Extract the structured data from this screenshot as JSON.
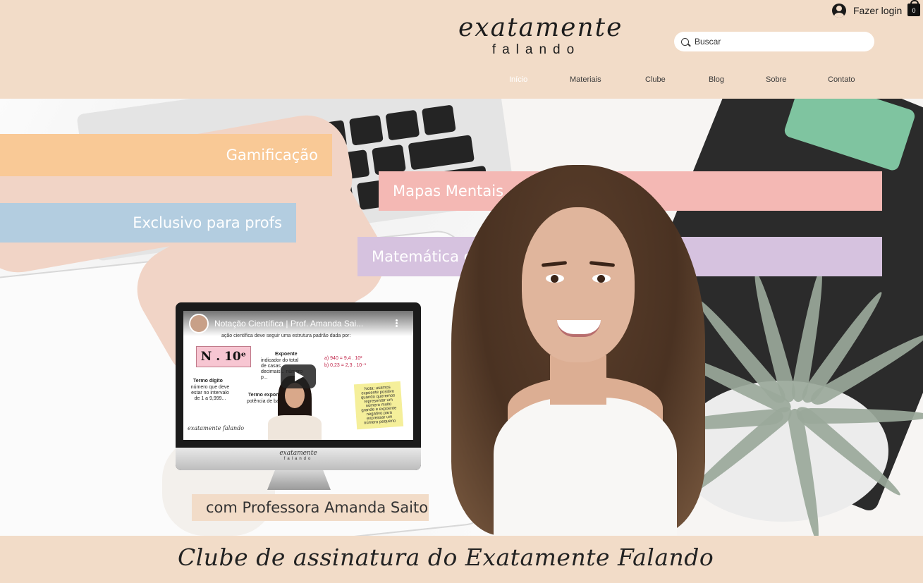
{
  "header": {
    "logo_main": "exatamente",
    "logo_sub": "falando",
    "login_label": "Fazer login",
    "cart_count": "0",
    "search": {
      "placeholder": "Buscar"
    }
  },
  "nav": {
    "items": [
      {
        "label": "Início",
        "active": true
      },
      {
        "label": "Materiais"
      },
      {
        "label": "Clube"
      },
      {
        "label": "Blog"
      },
      {
        "label": "Sobre"
      },
      {
        "label": "Contato"
      }
    ]
  },
  "hero": {
    "tags": {
      "gamificacao": "Gamificação",
      "exclusivo": "Exclusivo para profs",
      "mapas": "Mapas Mentais",
      "matematica": "Matemática criativa"
    },
    "video": {
      "title": "Notação Científica | Prof. Amanda Sai...",
      "subtitle": "ação científica deve seguir uma estrutura padrão dada por:",
      "formula": "N . 10ᵉ",
      "expoente": "Expoente",
      "expoente_desc": "indicador do total de casas decimais... número p...",
      "termo_digito": "Termo dígito",
      "termo_digito_desc": "número que deve estar no intervalo de 1 a 9,999...",
      "termo_exp": "Termo exponencial",
      "termo_exp_desc": "potência de base 10",
      "ex_a": "a) 940  =   9,4 . 10²",
      "ex_b": "b) 0,23 =   2,3 . 10⁻¹",
      "note": "Nota: usamos expoente positivo quando queremos representar um número muito grande e expoente negativo para expressar um número pequeno",
      "screen_logo": "exatamente falando",
      "chin_logo": "exatamente",
      "chin_sub": "falando"
    },
    "caption": "com Professora Amanda Saito"
  },
  "strip": {
    "title": "Clube de assinatura do Exatamente Falando"
  },
  "colors": {
    "header_bg": "#f2dcc8",
    "gamificacao": "#f9c996",
    "exclusivo": "#b3cde0",
    "mapas": "#f4b8b4",
    "matematica": "#d6c2df"
  }
}
